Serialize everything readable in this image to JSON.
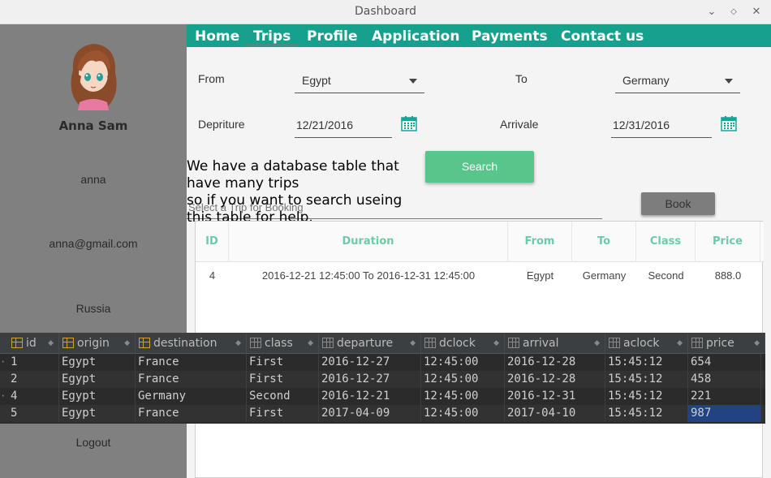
{
  "window": {
    "title": "Dashboard",
    "min_icon": "minimize-icon",
    "max_icon": "maximize-icon",
    "close_icon": "close-icon"
  },
  "sidebar": {
    "name": "Anna Sam",
    "login": "anna",
    "email": "anna@gmail.com",
    "country": "Russia",
    "logout": "Logout"
  },
  "nav": {
    "items": [
      "Home",
      "Trips",
      "Profile",
      "Application",
      "Payments",
      "Contact us"
    ],
    "active": "Trips"
  },
  "form": {
    "from_label": "From",
    "from_value": "Egypt",
    "to_label": "To",
    "to_value": "Germany",
    "departure_label": "Depriture",
    "departure_value": "12/21/2016",
    "arrival_label": "Arrivale",
    "arrival_value": "12/31/2016",
    "search_label": "Search",
    "book_label": "Book",
    "filter_placeholder": "Select a Trip for Booking"
  },
  "note": {
    "line1": "We have a database table that",
    "line2": "have many trips",
    "line3": "so if you want to search useing",
    "line4": "this table for help."
  },
  "results": {
    "headers": [
      "ID",
      "Duration",
      "From",
      "To",
      "Class",
      "Price"
    ],
    "rows": [
      [
        "4",
        "2016-12-21 12:45:00 To 2016-12-31 12:45:00",
        "Egypt",
        "Germany",
        "Second",
        "888.0"
      ]
    ]
  },
  "db": {
    "headers": [
      "id",
      "origin",
      "destination",
      "class",
      "departure",
      "dclock",
      "arrival",
      "aclock",
      "price"
    ],
    "rows": [
      [
        "1",
        "Egypt",
        "France",
        "First",
        "2016-12-27",
        "12:45:00",
        "2016-12-28",
        "15:45:12",
        "654"
      ],
      [
        "2",
        "Egypt",
        "France",
        "First",
        "2016-12-27",
        "12:45:00",
        "2016-12-28",
        "15:45:12",
        "458"
      ],
      [
        "4",
        "Egypt",
        "Germany",
        "Second",
        "2016-12-21",
        "12:45:00",
        "2016-12-31",
        "15:45:12",
        "221"
      ],
      [
        "5",
        "Egypt",
        "France",
        "First",
        "2017-04-09",
        "12:45:00",
        "2017-04-10",
        "15:45:12",
        "987"
      ]
    ],
    "selected_cell": "987"
  },
  "colors": {
    "nav_bg": "#16a08e",
    "sidebar_bg": "#808080",
    "search_btn": "#58c68a",
    "header_text": "#6ccba6",
    "db_bg": "#2b2b2b",
    "db_selection": "#214283"
  }
}
